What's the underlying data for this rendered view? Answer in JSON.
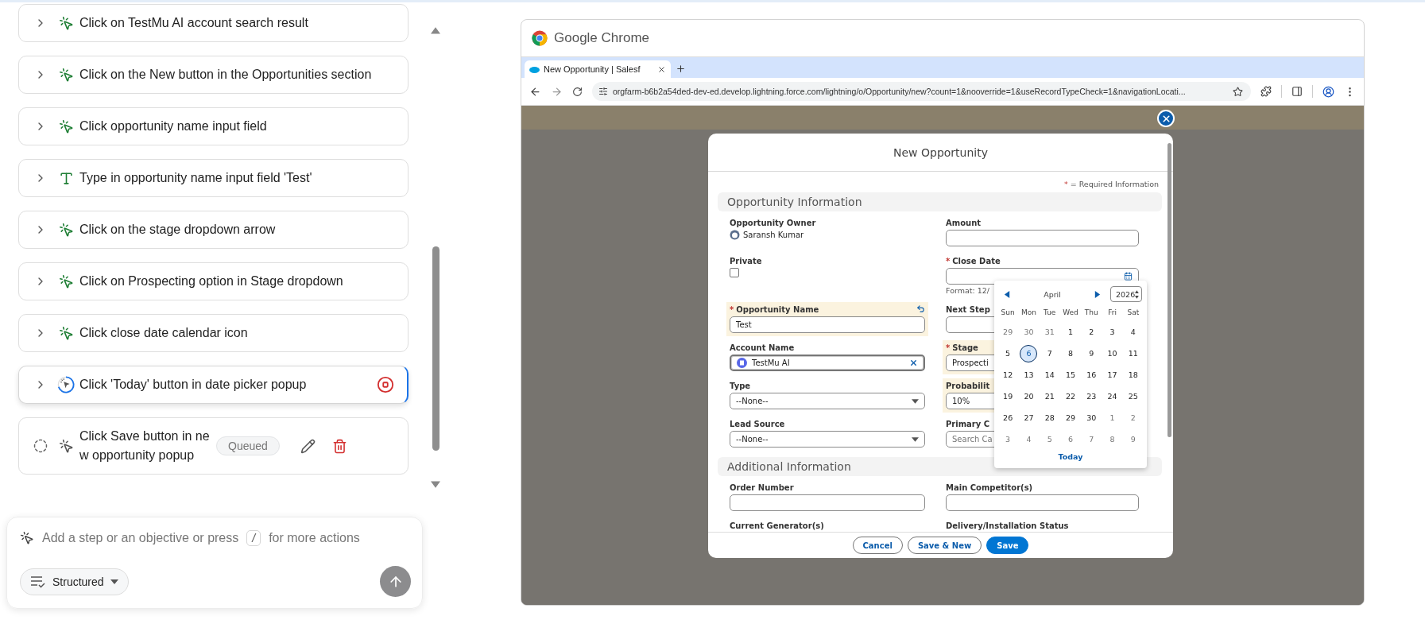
{
  "steps": [
    {
      "kind": "click",
      "completed": true,
      "running": false,
      "text": "Click on TestMu AI account search result"
    },
    {
      "kind": "click",
      "completed": true,
      "running": false,
      "text": "Click on the New button in the Opportunities section"
    },
    {
      "kind": "click",
      "completed": true,
      "running": false,
      "text": "Click opportunity name input field"
    },
    {
      "kind": "type",
      "completed": true,
      "running": false,
      "text": "Type in opportunity name input field 'Test'"
    },
    {
      "kind": "click",
      "completed": true,
      "running": false,
      "text": "Click on the stage dropdown arrow"
    },
    {
      "kind": "click",
      "completed": true,
      "running": false,
      "text": "Click on Prospecting option in Stage dropdown"
    },
    {
      "kind": "click",
      "completed": true,
      "running": false,
      "text": "Click close date calendar icon"
    },
    {
      "kind": "click",
      "completed": false,
      "running": true,
      "text": "Click 'Today' button in date picker popup"
    },
    {
      "kind": "click",
      "completed": false,
      "running": false,
      "text": "Click Save button in new opportunity popup",
      "badge": "Queued"
    }
  ],
  "composer": {
    "placeholder": "Add a step or an objective or press",
    "shortcut_key": "/",
    "hint_after": "for more actions",
    "mode": "Structured"
  },
  "browser": {
    "app_title": "Google Chrome",
    "tab": {
      "title": "New Opportunity | Salesf"
    },
    "url": "orgfarm-b6b2a54ded-dev-ed.develop.lightning.force.com/lightning/o/Opportunity/new?count=1&nooverride=1&useRecordTypeCheck=1&navigationLocati..."
  },
  "modal": {
    "title": "New Opportunity",
    "required_mark": "*",
    "required_note": "= Required Information",
    "sections": [
      {
        "title": "Opportunity Information",
        "fields": [
          {
            "kind": "owner",
            "label": "Opportunity Owner",
            "value": "Saransh Kumar",
            "required": false,
            "edited": false
          },
          {
            "kind": "input",
            "label": "Amount",
            "required": false,
            "edited": false
          },
          {
            "kind": "checkbox",
            "label": "Private",
            "checked": false,
            "required": false,
            "edited": false
          },
          {
            "kind": "date",
            "label": "Close Date",
            "help": "Format: 12/",
            "required": true,
            "edited": false
          },
          {
            "kind": "input",
            "label": "Opportunity Name",
            "value": "Test",
            "required": true,
            "edited": true
          },
          {
            "kind": "input",
            "label": "Next Step",
            "required": false,
            "edited": false
          },
          {
            "kind": "lookup",
            "label": "Account Name",
            "value": "TestMu AI",
            "required": false,
            "edited": false
          },
          {
            "kind": "input",
            "label": "Stage",
            "value": "Prospecti",
            "required": true,
            "edited": true
          },
          {
            "kind": "select",
            "label": "Type",
            "value": "--None--",
            "required": false,
            "edited": false
          },
          {
            "kind": "input",
            "label": "Probabilit",
            "value": "10%",
            "required": false,
            "edited": true
          },
          {
            "kind": "select",
            "label": "Lead Source",
            "value": "--None--",
            "required": false,
            "edited": false
          },
          {
            "kind": "input",
            "label": "Primary C",
            "placeholder": "Search Ca",
            "required": false,
            "edited": false
          }
        ]
      },
      {
        "title": "Additional Information",
        "fields": [
          {
            "kind": "input",
            "label": "Order Number",
            "required": false,
            "edited": false
          },
          {
            "kind": "input",
            "label": "Main Competitor(s)",
            "required": false,
            "edited": false
          },
          {
            "kind": "label",
            "label": "Current Generator(s)",
            "required": false,
            "edited": false
          },
          {
            "kind": "label",
            "label": "Delivery/Installation Status",
            "required": false,
            "edited": false
          }
        ]
      }
    ],
    "buttons": [
      {
        "label": "Cancel",
        "primary": false
      },
      {
        "label": "Save & New",
        "primary": false
      },
      {
        "label": "Save",
        "primary": true
      }
    ],
    "date_picker": {
      "month": "April",
      "year": "2026",
      "weekdays": [
        "Sun",
        "Mon",
        "Tue",
        "Wed",
        "Thu",
        "Fri",
        "Sat"
      ],
      "weeks": [
        [
          {
            "label": "29",
            "outside": true,
            "selected": false
          },
          {
            "label": "30",
            "outside": true,
            "selected": false
          },
          {
            "label": "31",
            "outside": true,
            "selected": false
          },
          {
            "label": "1",
            "outside": false,
            "selected": false
          },
          {
            "label": "2",
            "outside": false,
            "selected": false
          },
          {
            "label": "3",
            "outside": false,
            "selected": false
          },
          {
            "label": "4",
            "outside": false,
            "selected": false
          }
        ],
        [
          {
            "label": "5",
            "outside": false,
            "selected": false
          },
          {
            "label": "6",
            "outside": false,
            "selected": true
          },
          {
            "label": "7",
            "outside": false,
            "selected": false
          },
          {
            "label": "8",
            "outside": false,
            "selected": false
          },
          {
            "label": "9",
            "outside": false,
            "selected": false
          },
          {
            "label": "10",
            "outside": false,
            "selected": false
          },
          {
            "label": "11",
            "outside": false,
            "selected": false
          }
        ],
        [
          {
            "label": "12",
            "outside": false,
            "selected": false
          },
          {
            "label": "13",
            "outside": false,
            "selected": false
          },
          {
            "label": "14",
            "outside": false,
            "selected": false
          },
          {
            "label": "15",
            "outside": false,
            "selected": false
          },
          {
            "label": "16",
            "outside": false,
            "selected": false
          },
          {
            "label": "17",
            "outside": false,
            "selected": false
          },
          {
            "label": "18",
            "outside": false,
            "selected": false
          }
        ],
        [
          {
            "label": "19",
            "outside": false,
            "selected": false
          },
          {
            "label": "20",
            "outside": false,
            "selected": false
          },
          {
            "label": "21",
            "outside": false,
            "selected": false
          },
          {
            "label": "22",
            "outside": false,
            "selected": false
          },
          {
            "label": "23",
            "outside": false,
            "selected": false
          },
          {
            "label": "24",
            "outside": false,
            "selected": false
          },
          {
            "label": "25",
            "outside": false,
            "selected": false
          }
        ],
        [
          {
            "label": "26",
            "outside": false,
            "selected": false
          },
          {
            "label": "27",
            "outside": false,
            "selected": false
          },
          {
            "label": "28",
            "outside": false,
            "selected": false
          },
          {
            "label": "29",
            "outside": false,
            "selected": false
          },
          {
            "label": "30",
            "outside": false,
            "selected": false
          },
          {
            "label": "1",
            "outside": true,
            "selected": false
          },
          {
            "label": "2",
            "outside": true,
            "selected": false
          }
        ],
        [
          {
            "label": "3",
            "outside": true,
            "selected": false
          },
          {
            "label": "4",
            "outside": true,
            "selected": false
          },
          {
            "label": "5",
            "outside": true,
            "selected": false
          },
          {
            "label": "6",
            "outside": true,
            "selected": false
          },
          {
            "label": "7",
            "outside": true,
            "selected": false
          },
          {
            "label": "8",
            "outside": true,
            "selected": false
          },
          {
            "label": "9",
            "outside": true,
            "selected": false
          }
        ]
      ],
      "today_button": "Today"
    }
  }
}
